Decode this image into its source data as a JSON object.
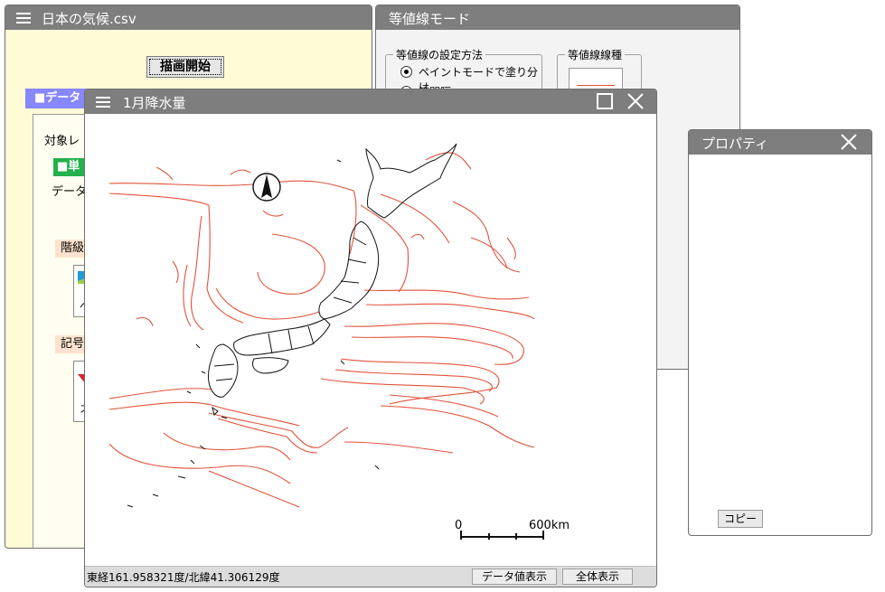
{
  "data_window": {
    "title": "日本の気候.csv",
    "start_button": "描画開始",
    "section_label": "■データ",
    "target_label": "対象レ",
    "single_badge": "■単",
    "data_label": "データ",
    "class_label": "階級",
    "symbol_label": "記号",
    "swatch_caption_1": "ペ",
    "swatch_caption_2": "ス"
  },
  "contour_window": {
    "title": "等値線モード",
    "group_method_legend": "等値線の設定方法",
    "option_paint": "ペイントモードで塗り分け",
    "option_interval": "等間隔",
    "group_linetype_legend": "等値線線種"
  },
  "map_window": {
    "title": "1月降水量",
    "scale_start": "0",
    "scale_end": "600km",
    "status_coordinates": "東経161.958321度/北緯41.306129度",
    "button_show_values": "データ値表示",
    "button_show_all": "全体表示"
  },
  "property_window": {
    "title": "プロパティ",
    "copy_button": "コピー"
  },
  "colors": {
    "titlebar": "#7e7e7e",
    "contour_line": "#e0533a",
    "yellow_panel": "#fffbd6",
    "section_header": "#8787ff",
    "badge_green": "#22b14c"
  }
}
